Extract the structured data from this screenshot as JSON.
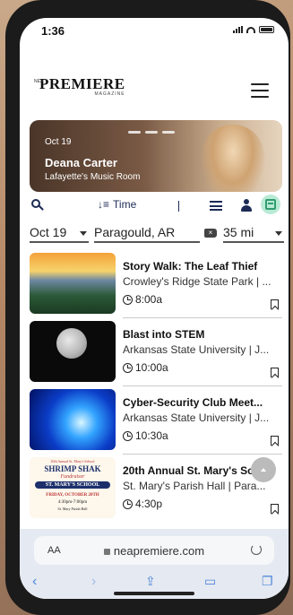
{
  "status": {
    "time": "1:36"
  },
  "header": {
    "logo_sub": "NEA",
    "logo_main": "PREMIERE",
    "logo_tag": "MAGAZINE"
  },
  "hero": {
    "date": "Oct 19",
    "title": "Deana Carter",
    "venue": "Lafayette's Music Room",
    "slides": 3
  },
  "toolbar": {
    "sort_label": "Time",
    "search_icon": "search-icon",
    "list_icon": "list-view-icon",
    "user_icon": "user-icon",
    "calendar_icon": "calendar-icon",
    "calendar_bg": "#b9ead6"
  },
  "filters": {
    "date": "Oct 19",
    "location": "Paragould, AR",
    "distance": "35 mi"
  },
  "events": [
    {
      "title": "Story Walk: The Leaf Thief",
      "venue": "Crowley's Ridge State Park | ...",
      "time": "8:00a"
    },
    {
      "title": "Blast into STEM",
      "venue": "Arkansas State University | J...",
      "time": "10:00a"
    },
    {
      "title": "Cyber-Security Club Meet...",
      "venue": "Arkansas State University | J...",
      "time": "10:30a"
    },
    {
      "title": "20th Annual St. Mary's Sc...",
      "venue": "St. Mary's Parish Hall | Para...",
      "time": "4:30p"
    }
  ],
  "shrimp_flyer": {
    "line1": "20th Annual St. Mary's School",
    "line2": "SHRIMP SHAK",
    "line3": "Fundraiser",
    "line4": "ST. MARY'S SCHOOL",
    "line5": "FRIDAY, OCTOBER 20TH",
    "line6": "4:30pm-7:00pm",
    "line7": "St. Mary Parish Hall"
  },
  "browser": {
    "text_size_label": "AA",
    "url": "neapremiere.com"
  }
}
